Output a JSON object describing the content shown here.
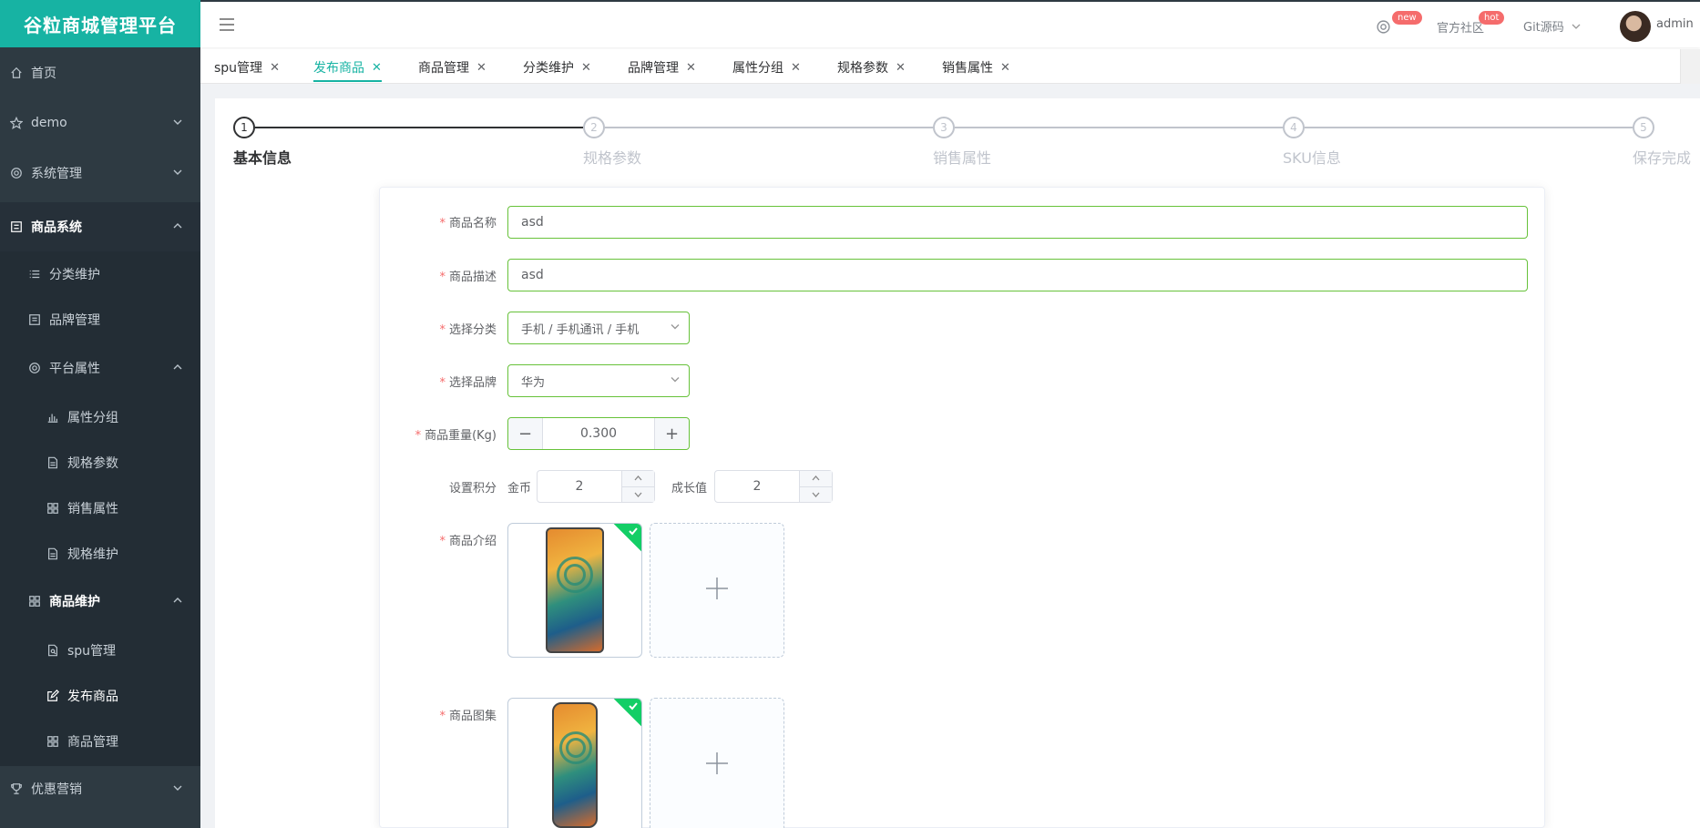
{
  "app": {
    "logo_text": "谷粒商城管理平台"
  },
  "sidebar": {
    "items": [
      {
        "label": "首页",
        "icon": "home-icon"
      },
      {
        "label": "demo",
        "icon": "star-icon"
      },
      {
        "label": "系统管理",
        "icon": "gear-icon"
      },
      {
        "label": "商品系统",
        "icon": "list-box-icon"
      },
      {
        "label": "分类维护",
        "icon": "list-icon"
      },
      {
        "label": "品牌管理",
        "icon": "document-icon"
      },
      {
        "label": "平台属性",
        "icon": "gear-icon"
      },
      {
        "label": "属性分组",
        "icon": "bar-chart-icon"
      },
      {
        "label": "规格参数",
        "icon": "file-icon"
      },
      {
        "label": "销售属性",
        "icon": "grid-icon"
      },
      {
        "label": "规格维护",
        "icon": "file-icon"
      },
      {
        "label": "商品维护",
        "icon": "grid-icon"
      },
      {
        "label": "spu管理",
        "icon": "file-search-icon"
      },
      {
        "label": "发布商品",
        "icon": "edit-icon"
      },
      {
        "label": "商品管理",
        "icon": "grid-icon"
      },
      {
        "label": "优惠营销",
        "icon": "trophy-icon"
      }
    ]
  },
  "header": {
    "badge_new": "new",
    "community": "官方社区",
    "badge_hot": "hot",
    "git": "Git源码",
    "user": "admin"
  },
  "tabs": [
    {
      "label": "spu管理"
    },
    {
      "label": "发布商品"
    },
    {
      "label": "商品管理"
    },
    {
      "label": "分类维护"
    },
    {
      "label": "品牌管理"
    },
    {
      "label": "属性分组"
    },
    {
      "label": "规格参数"
    },
    {
      "label": "销售属性"
    }
  ],
  "steps": [
    {
      "num": "1",
      "title": "基本信息"
    },
    {
      "num": "2",
      "title": "规格参数"
    },
    {
      "num": "3",
      "title": "销售属性"
    },
    {
      "num": "4",
      "title": "SKU信息"
    },
    {
      "num": "5",
      "title": "保存完成"
    }
  ],
  "form": {
    "name_label": "商品名称",
    "name_value": "asd",
    "desc_label": "商品描述",
    "desc_value": "asd",
    "category_label": "选择分类",
    "category_value": "手机 / 手机通讯 / 手机",
    "brand_label": "选择品牌",
    "brand_value": "华为",
    "weight_label": "商品重量(Kg)",
    "weight_value": "0.300",
    "points_label": "设置积分",
    "gold_label": "金币",
    "gold_value": "2",
    "growth_label": "成长值",
    "growth_value": "2",
    "intro_label": "商品介绍",
    "images_label": "商品图集"
  },
  "colors": {
    "brand": "#17b3a3",
    "sidebar_bg": "#2e3a42",
    "valid_border": "#67c23a",
    "required": "#f56c6c",
    "success_corner": "#13ce66"
  }
}
